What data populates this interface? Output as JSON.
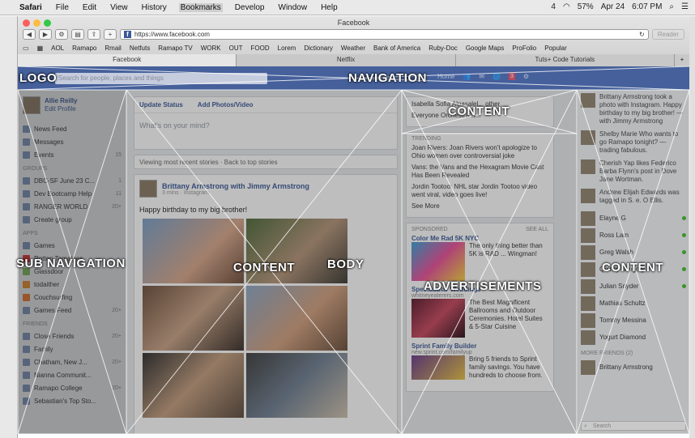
{
  "menubar": {
    "app": "Safari",
    "items": [
      "File",
      "Edit",
      "View",
      "History",
      "Bookmarks",
      "Develop",
      "Window",
      "Help"
    ],
    "status": [
      "4",
      "57%",
      "Apr 24",
      "6:07 PM"
    ]
  },
  "window": {
    "title": "Facebook",
    "url": "https://www.facebook.com",
    "reader": "Reader",
    "bookmarks": [
      "AOL",
      "Ramapo",
      "Rmail",
      "Netfuts",
      "Ramapo TV",
      "WORK",
      "OUT",
      "FOOD",
      "Lorem",
      "Dictionary",
      "Weather",
      "Bank of America",
      "Ruby-Doc",
      "Google Maps",
      "ProFolio",
      "Popular"
    ],
    "tabs": [
      "Facebook",
      "Netflix",
      "Tuts+ Code Tutorials"
    ]
  },
  "fb": {
    "search_placeholder": "Search for people, places and things",
    "nav_home": "Home",
    "profile_name": "Allie Reilly",
    "profile_edit": "Edit Profile",
    "side_items": [
      {
        "label": "News Feed",
        "count": ""
      },
      {
        "label": "Messages",
        "count": ""
      },
      {
        "label": "Events",
        "count": "15"
      }
    ],
    "groups_head": "Groups",
    "groups": [
      {
        "label": "DBC-SF June 23 C...",
        "count": "1"
      },
      {
        "label": "Dev Bootcamp Help",
        "count": "11"
      },
      {
        "label": "RANGER WORLD",
        "count": "20+"
      },
      {
        "label": "Create group",
        "count": ""
      }
    ],
    "apps_head": "Apps",
    "apps": [
      {
        "label": "Games",
        "count": ""
      },
      {
        "label": "Rotten Tomatoes",
        "count": ""
      },
      {
        "label": "Glassdoor",
        "count": ""
      },
      {
        "label": "todaither",
        "count": ""
      },
      {
        "label": "Couchsurfing",
        "count": ""
      },
      {
        "label": "Games Feed",
        "count": "20+"
      }
    ],
    "friends_head": "Friends",
    "friends": [
      {
        "label": "Close Friends",
        "count": "20+"
      },
      {
        "label": "Family",
        "count": ""
      },
      {
        "label": "Chatham, New J...",
        "count": "20+"
      },
      {
        "label": "Nianna Communit...",
        "count": ""
      },
      {
        "label": "Ramapo College",
        "count": "20+"
      },
      {
        "label": "Sebastian's Top Sto...",
        "count": ""
      }
    ],
    "composer_update": "Update Status",
    "composer_photo": "Add Photos/Video",
    "composer_prompt": "What's on your mind?",
    "story_hint": "Viewing most recent stories · Back to top stories",
    "post_author": "Brittany Armstrong with Jimmy Armstrong",
    "post_meta": "3 mins · Instagram",
    "post_text": "Happy birthday to my big brother!",
    "ticker_top": "Isabella Sofia Alpasalel... other",
    "ticker_top2": "Everyone Orchestra w...",
    "trending_head": "Trending",
    "trending": [
      "Joan Rivers: Joan Rivers won't apologize to Ohio women over controversial joke",
      "Vans: the Vans and the Hexagram Movie Cast Has Been Revealed",
      "Jordin Tootoo: NHL star Jordin Tootoo video went viral, video goes live!"
    ],
    "see_more": "See More",
    "sponsored_head": "Sponsored",
    "see_all": "See All",
    "ads": [
      {
        "title": "Color Me Rad 5K NYC",
        "url": "",
        "text": "The only thing better than 5K is RAD ... Wingman!"
      },
      {
        "title": "Spectacular Weddings",
        "url": "whitneyeaterers.com",
        "text": "The Best Magnificent Ballrooms and Outdoor Ceremonies. Hotel Suites & 5-Star Cuisine"
      },
      {
        "title": "Sprint Family Builder",
        "url": "new.sprint.com/familyup",
        "text": "Bring 5 friends to Sprint family savings. You have hundreds to choose from."
      }
    ],
    "chat_ticker": [
      "Brittany Armstrong took a photo with Instagram. Happy birthday to my big brother! — with Jimmy Armstrong",
      "Shelby Marie Who wants to go Ramapo tonight? — trading fabulous.",
      "Cherish Yap likes Federico Barba Flynn's post in Dove Jane Wortman.",
      "Andrew Elijah Edwards was tagged in S. e. O Ellis."
    ],
    "chat_people": [
      "Elayne G",
      "Ross Lam",
      "Greg Walsh",
      "Quincy Gregory",
      "Julian Snyder",
      "Mathias Schultz",
      "Tommy Messina",
      "Yogurt Diamond"
    ],
    "chat_more_head": "More Friends (2)",
    "chat_more": "Brittany Armstrong",
    "chat_search": "Search",
    "notif_badge": "3"
  },
  "labels": {
    "logo": "LOGO",
    "navigation": "NAVIGATION",
    "content_top": "CONTENT",
    "sub_navigation": "SUB NAVIGATION",
    "content_center": "CONTENT",
    "body": "BODY",
    "advertisements": "ADVERTISEMENTS",
    "content_right": "CONTENT"
  }
}
